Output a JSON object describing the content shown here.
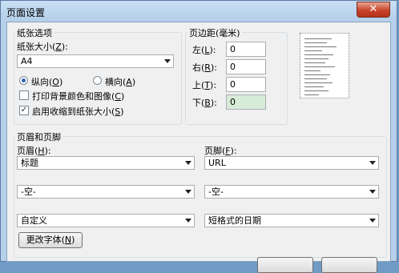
{
  "window": {
    "title": "页面设置",
    "close_glyph": "✕"
  },
  "paper": {
    "group_label": "纸张选项",
    "size_label_pre": "纸张大小(",
    "size_label_key": "Z",
    "size_label_post": "):",
    "size_value": "A4",
    "portrait_pre": "纵向(",
    "portrait_key": "O",
    "portrait_post": ")",
    "landscape_pre": "横向(",
    "landscape_key": "A",
    "landscape_post": ")",
    "orientation_selected": "portrait",
    "print_bg_pre": "打印背景颜色和图像(",
    "print_bg_key": "C",
    "print_bg_post": ")",
    "print_bg_checked": false,
    "shrink_pre": "启用收缩到纸张大小(",
    "shrink_key": "S",
    "shrink_post": ")",
    "shrink_checked": true
  },
  "margins": {
    "group_label": "页边距(毫米)",
    "left_pre": "左(",
    "left_key": "L",
    "left_post": "):",
    "left_value": "0",
    "right_pre": "右(",
    "right_key": "R",
    "right_post": "):",
    "right_value": "0",
    "top_pre": "上(",
    "top_key": "T",
    "top_post": "):",
    "top_value": "0",
    "bottom_pre": "下(",
    "bottom_key": "B",
    "bottom_post": "):",
    "bottom_value": "0"
  },
  "header_footer": {
    "group_label": "页眉和页脚",
    "header_pre": "页眉(",
    "header_key": "H",
    "header_post": "):",
    "footer_pre": "页脚(",
    "footer_key": "F",
    "footer_post": "):",
    "header_1": "标题",
    "header_2": "-空-",
    "header_3": "自定义",
    "footer_1": "URL",
    "footer_2": "-空-",
    "footer_3": "短格式的日期",
    "font_btn_pre": "更改字体(",
    "font_btn_key": "N",
    "font_btn_post": ")"
  }
}
